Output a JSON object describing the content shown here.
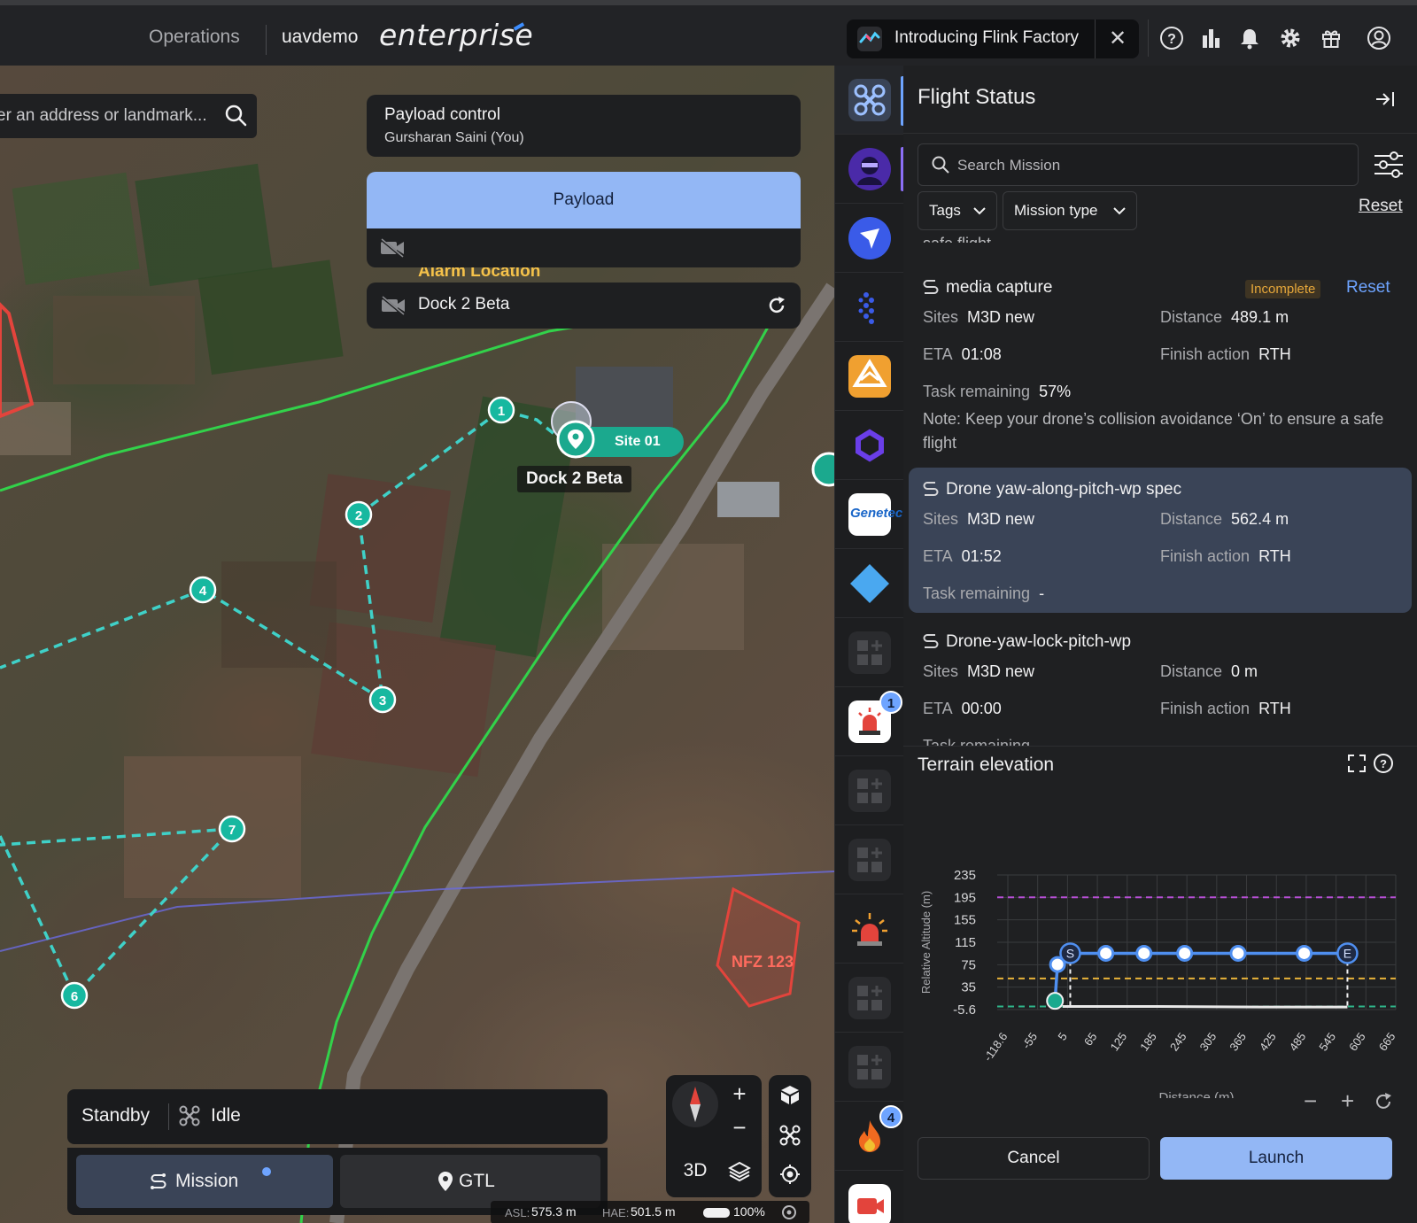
{
  "topbar": {
    "nav_label": "Operations",
    "org_name": "uavdemo",
    "product_name": "enterprise",
    "announcement": "Introducing Flink Factory"
  },
  "map": {
    "search_placeholder": "Enter an address or landmark...",
    "search_value": "er an address or landmark...",
    "payload_control_title": "Payload control",
    "payload_control_user": "Gursharan Saini (You)",
    "payload_button": "Payload",
    "alarm_label": "Alarm Location",
    "dock_selector": "Dock 2 Beta",
    "site_label": "Site 01",
    "dock_map_label": "Dock 2 Beta",
    "nfz_label": "NFZ 123",
    "waypoints": [
      "1",
      "2",
      "3",
      "4",
      "6",
      "7"
    ],
    "status": "Standby",
    "drone_state": "Idle",
    "tab_mission": "Mission",
    "tab_gtl": "GTL",
    "view_mode": "3D",
    "readout": {
      "asl_label": "ASL:",
      "asl_value": "575.3 m",
      "hae_label": "HAE:",
      "hae_value": "501.5 m",
      "battery": "100%"
    }
  },
  "rail": {
    "badge_alarm": "1",
    "badge_fire": "4",
    "icons": [
      "drone-icon",
      "ninja-avatar-icon",
      "send-icon",
      "dots-logo-icon",
      "warning-app-icon",
      "ring-icon",
      "genetec-icon",
      "diamond-icon",
      "add-widget-icon",
      "siren-icon",
      "add-widget-icon",
      "add-widget-icon",
      "alarm-light-icon",
      "add-widget-icon",
      "add-widget-icon",
      "fire-icon",
      "camera-app-icon"
    ],
    "genetec_text": "Genetec"
  },
  "panel": {
    "title": "Flight Status",
    "search_placeholder": "Search Mission",
    "filter_tags": "Tags",
    "filter_mission_type": "Mission type",
    "reset": "Reset",
    "partial_top_text": "safe flight",
    "labels": {
      "sites": "Sites",
      "distance": "Distance",
      "eta": "ETA",
      "finish_action": "Finish action",
      "task_remaining": "Task remaining"
    },
    "missions": [
      {
        "name": "media capture",
        "badge": "Incomplete",
        "reset": "Reset",
        "sites": "M3D new",
        "distance": "489.1 m",
        "eta": "01:08",
        "finish_action": "RTH",
        "task_remaining": "57%",
        "note": "Note: Keep your drone’s collision avoidance ‘On’ to ensure a safe flight"
      },
      {
        "name": "Drone yaw-along-pitch-wp spec",
        "sites": "M3D new",
        "distance": "562.4 m",
        "eta": "01:52",
        "finish_action": "RTH",
        "task_remaining": "-"
      },
      {
        "name": "Drone-yaw-lock-pitch-wp",
        "sites": "M3D new",
        "distance": "0 m",
        "eta": "00:00",
        "finish_action": "RTH",
        "task_remaining": "-"
      }
    ],
    "terrain_title": "Terrain elevation",
    "cancel": "Cancel",
    "launch": "Launch"
  },
  "chart_data": {
    "type": "line",
    "title": "",
    "xlabel": "Distance  (m)",
    "ylabel": "Relative Altitude  (m)",
    "x_ticks": [
      "-118.6",
      "-55",
      "5",
      "65",
      "125",
      "185",
      "245",
      "305",
      "365",
      "425",
      "485",
      "545",
      "605",
      "665"
    ],
    "y_ticks": [
      "235",
      "195",
      "155",
      "115",
      "75",
      "35",
      "-5.6"
    ],
    "xlim": [
      -118.6,
      665
    ],
    "ylim": [
      -5.6,
      235
    ],
    "grid": true,
    "colors": {
      "route": "#4f8ff0",
      "terrain": "#e9e9e9",
      "upper_limit": "#b84fd6",
      "safety": "#e8b23a",
      "ground": "#2fb58a"
    },
    "series": [
      {
        "kind": "route",
        "points": [
          {
            "x": -5,
            "y": 10,
            "label": "home"
          },
          {
            "x": 0,
            "y": 75
          },
          {
            "x": 25,
            "y": 95,
            "label": "S"
          },
          {
            "x": 95,
            "y": 95
          },
          {
            "x": 170,
            "y": 95
          },
          {
            "x": 250,
            "y": 95
          },
          {
            "x": 355,
            "y": 95
          },
          {
            "x": 485,
            "y": 95
          },
          {
            "x": 570,
            "y": 95,
            "label": "E"
          }
        ]
      },
      {
        "kind": "terrain",
        "points": [
          {
            "x": 10,
            "y": 0
          },
          {
            "x": 200,
            "y": 0
          },
          {
            "x": 400,
            "y": -1
          },
          {
            "x": 570,
            "y": -1
          }
        ]
      }
    ],
    "reference_lines": [
      {
        "kind": "upper_limit",
        "y": 195
      },
      {
        "kind": "safety",
        "y": 50
      },
      {
        "kind": "ground",
        "y": 0
      }
    ]
  }
}
